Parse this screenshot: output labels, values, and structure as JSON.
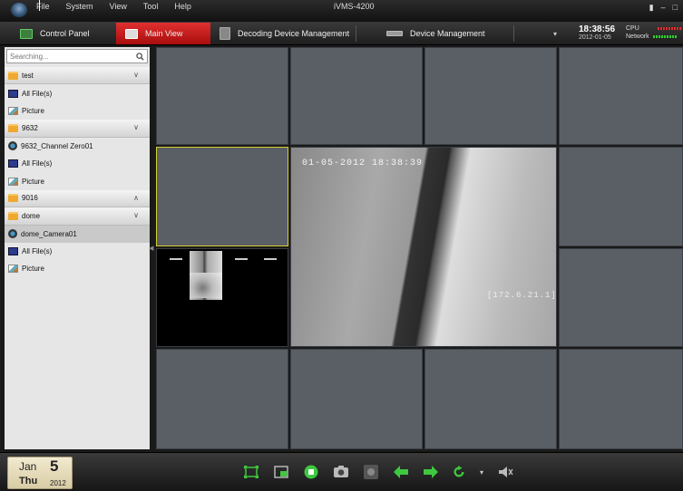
{
  "window": {
    "title": "iVMS-4200",
    "menu": [
      "File",
      "System",
      "View",
      "Tool",
      "Help"
    ],
    "controls": [
      "▮",
      "–",
      "□"
    ]
  },
  "tabs": [
    {
      "label": "Control Panel",
      "active": false
    },
    {
      "label": "Main View",
      "active": true
    },
    {
      "label": "Decoding Device Management",
      "active": false
    },
    {
      "label": "Device Management",
      "active": false
    }
  ],
  "clock": {
    "time": "18:38:56",
    "date": "2012-01-05"
  },
  "stats": {
    "cpu_label": "CPU",
    "network_label": "Network"
  },
  "search": {
    "placeholder": "Searching..."
  },
  "tree": [
    {
      "kind": "group",
      "label": "test",
      "icon": "folder-icon",
      "expanded": true
    },
    {
      "kind": "item",
      "label": "All File(s)",
      "icon": "files-icon"
    },
    {
      "kind": "item",
      "label": "Picture",
      "icon": "picture-icon"
    },
    {
      "kind": "group",
      "label": "9632",
      "icon": "folder-icon",
      "expanded": true
    },
    {
      "kind": "item",
      "label": "9632_Channel Zero01",
      "icon": "camera-icon"
    },
    {
      "kind": "item",
      "label": "All File(s)",
      "icon": "files-icon"
    },
    {
      "kind": "item",
      "label": "Picture",
      "icon": "picture-icon"
    },
    {
      "kind": "group",
      "label": "9016",
      "icon": "folder-icon",
      "expanded": false
    },
    {
      "kind": "group",
      "label": "dome",
      "icon": "folder-icon",
      "expanded": true
    },
    {
      "kind": "item",
      "label": "dome_Camera01",
      "icon": "camera-icon",
      "selected": true
    },
    {
      "kind": "item",
      "label": "All File(s)",
      "icon": "files-icon"
    },
    {
      "kind": "item",
      "label": "Picture",
      "icon": "picture-icon"
    }
  ],
  "video": {
    "osd_timestamp": "01-05-2012 18:38:39",
    "osd_ip": "[172.6.21.1]"
  },
  "bottom": {
    "month": "Jan",
    "day": "5",
    "weekday": "Thu",
    "year": "2012"
  },
  "toolbar_icons": [
    "fullscreen-icon",
    "layout-icon",
    "stop-all-icon",
    "capture-icon",
    "disabled-icon",
    "previous-icon",
    "next-icon",
    "refresh-icon",
    "refresh-dropdown-icon",
    "volume-icon"
  ],
  "colors": {
    "active_tab": "#c81818",
    "active_window_border": "#d2cd30",
    "cell_bg": "#5a5f66",
    "controls_green": "#3fc83f"
  }
}
